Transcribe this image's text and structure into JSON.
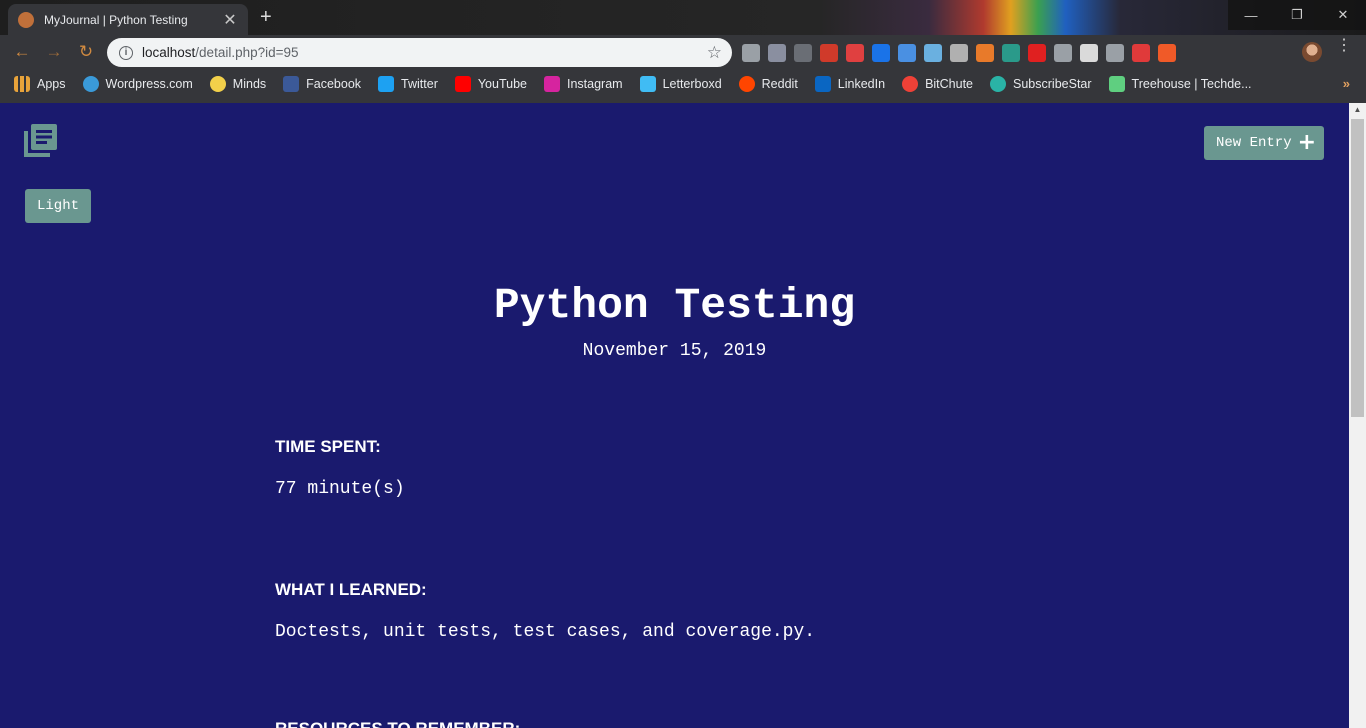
{
  "browser": {
    "tab_title": "MyJournal | Python Testing",
    "url_host": "localhost",
    "url_path": "/detail.php?id=95",
    "extension_colors": [
      "#9aa0a6",
      "#8a8fa0",
      "#6a6e75",
      "#d03a2a",
      "#e04040",
      "#1a73e8",
      "#4a90e2",
      "#6ab0e0",
      "#b0b0b0",
      "#e87a2a",
      "#2a9a8a",
      "#e02020",
      "#9aa0a6",
      "#dadada",
      "#9aa0a6",
      "#e03a3a",
      "#f05a28"
    ]
  },
  "bookmarks": [
    {
      "label": "Apps",
      "icon": "apps-grid-icon",
      "color": "#e8a33a"
    },
    {
      "label": "Wordpress.com",
      "icon": "wordpress-icon",
      "color": "#3a9ad9"
    },
    {
      "label": "Minds",
      "icon": "minds-bulb-icon",
      "color": "#f2d04a"
    },
    {
      "label": "Facebook",
      "icon": "facebook-icon",
      "color": "#3b5998"
    },
    {
      "label": "Twitter",
      "icon": "twitter-icon",
      "color": "#1da1f2"
    },
    {
      "label": "YouTube",
      "icon": "youtube-icon",
      "color": "#ff0000"
    },
    {
      "label": "Instagram",
      "icon": "instagram-icon",
      "color": "#d6249f"
    },
    {
      "label": "Letterboxd",
      "icon": "letterboxd-icon",
      "color": "#40bcf4"
    },
    {
      "label": "Reddit",
      "icon": "reddit-icon",
      "color": "#ff4500"
    },
    {
      "label": "LinkedIn",
      "icon": "linkedin-icon",
      "color": "#0a66c2"
    },
    {
      "label": "BitChute",
      "icon": "bitchute-icon",
      "color": "#ef4137"
    },
    {
      "label": "SubscribeStar",
      "icon": "subscribestar-icon",
      "color": "#2ab3a6"
    },
    {
      "label": "Treehouse | Techde...",
      "icon": "treehouse-icon",
      "color": "#5fcf80"
    }
  ],
  "header": {
    "new_entry_label": "New Entry",
    "theme_toggle_label": "Light"
  },
  "entry": {
    "title": "Python Testing",
    "date": "November 15, 2019",
    "time_spent_heading": "TIME SPENT:",
    "time_spent_value": "77 minute(s)",
    "learned_heading": "WHAT I LEARNED:",
    "learned_value": "Doctests, unit tests, test cases, and coverage.py.",
    "resources_heading": "RESOURCES TO REMEMBER:"
  },
  "colors": {
    "page_background": "#1a1a6e",
    "button_background": "#6a9790",
    "logo_color": "#6a9790"
  }
}
